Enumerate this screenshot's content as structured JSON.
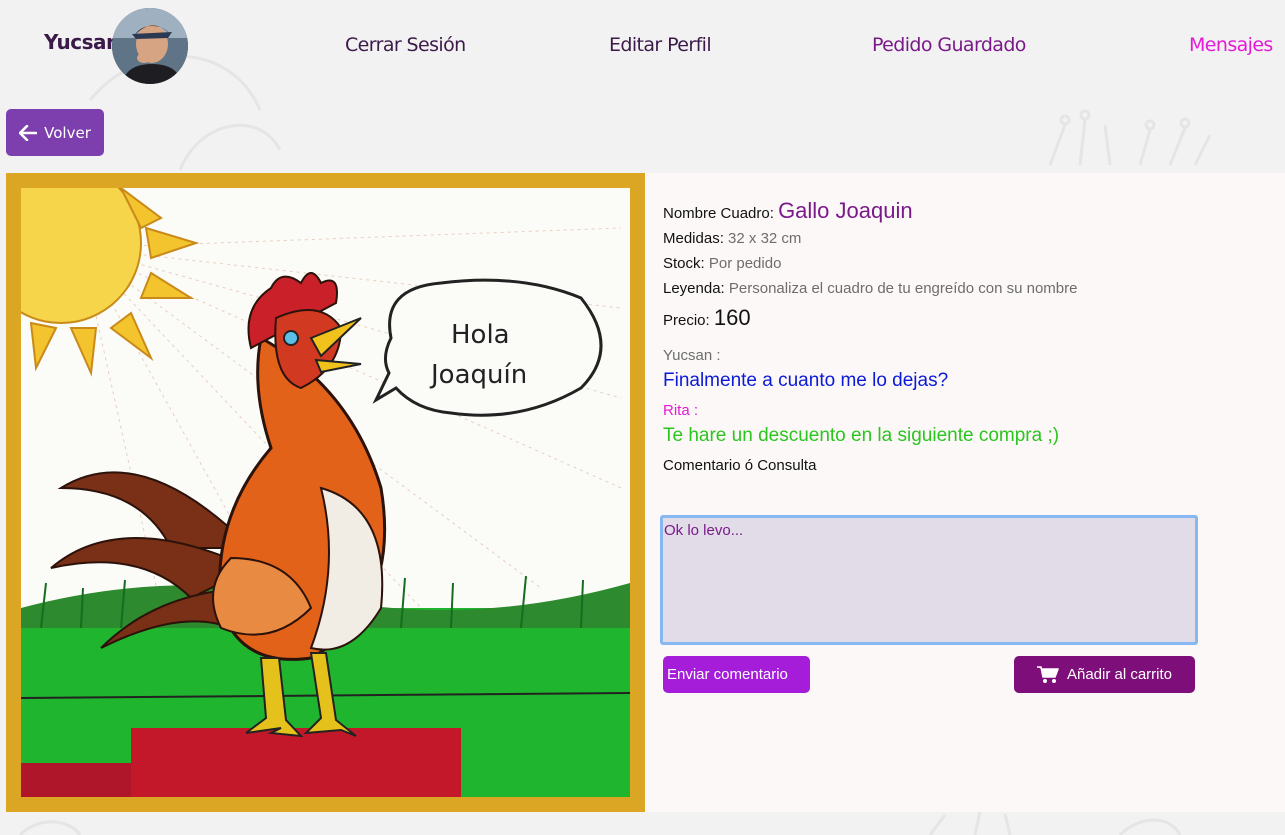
{
  "header": {
    "user_name": "Yucsan",
    "nav": {
      "logout": "Cerrar Sesión",
      "edit_profile": "Editar Perfil",
      "saved_order": "Pedido Guardado",
      "messages": "Mensajes"
    }
  },
  "back_button": {
    "label": "Volver",
    "icon": "arrow-left-icon"
  },
  "product": {
    "name_label": "Nombre Cuadro:",
    "name": "Gallo Joaquin",
    "size_label": "Medidas:",
    "size": "32 x 32 cm",
    "stock_label": "Stock:",
    "stock": "Por pedido",
    "legend_label": "Leyenda:",
    "legend": "Personaliza el cuadro de tu engreído con su nombre",
    "price_label": "Precio:",
    "price": "160",
    "image_speech_line1": "Hola",
    "image_speech_line2": "Joaquín"
  },
  "messages": [
    {
      "author": "Yucsan :",
      "text": "Finalmente a cuanto me lo dejas?"
    },
    {
      "author": "Rita :",
      "text": "Te hare un descuento en la siguiente compra ;)"
    }
  ],
  "comment": {
    "label": "Comentario ó Consulta",
    "value": "Ok lo levo..."
  },
  "actions": {
    "send_label": "Enviar comentario",
    "cart_label": "Añadir al carrito",
    "cart_icon": "cart-icon"
  },
  "colors": {
    "brand_purple": "#7d3fae",
    "frame_gold": "#dba624",
    "accent_magenta": "#e41ad7",
    "message_blue": "#0a1ad6",
    "message_green": "#2bc51e"
  }
}
